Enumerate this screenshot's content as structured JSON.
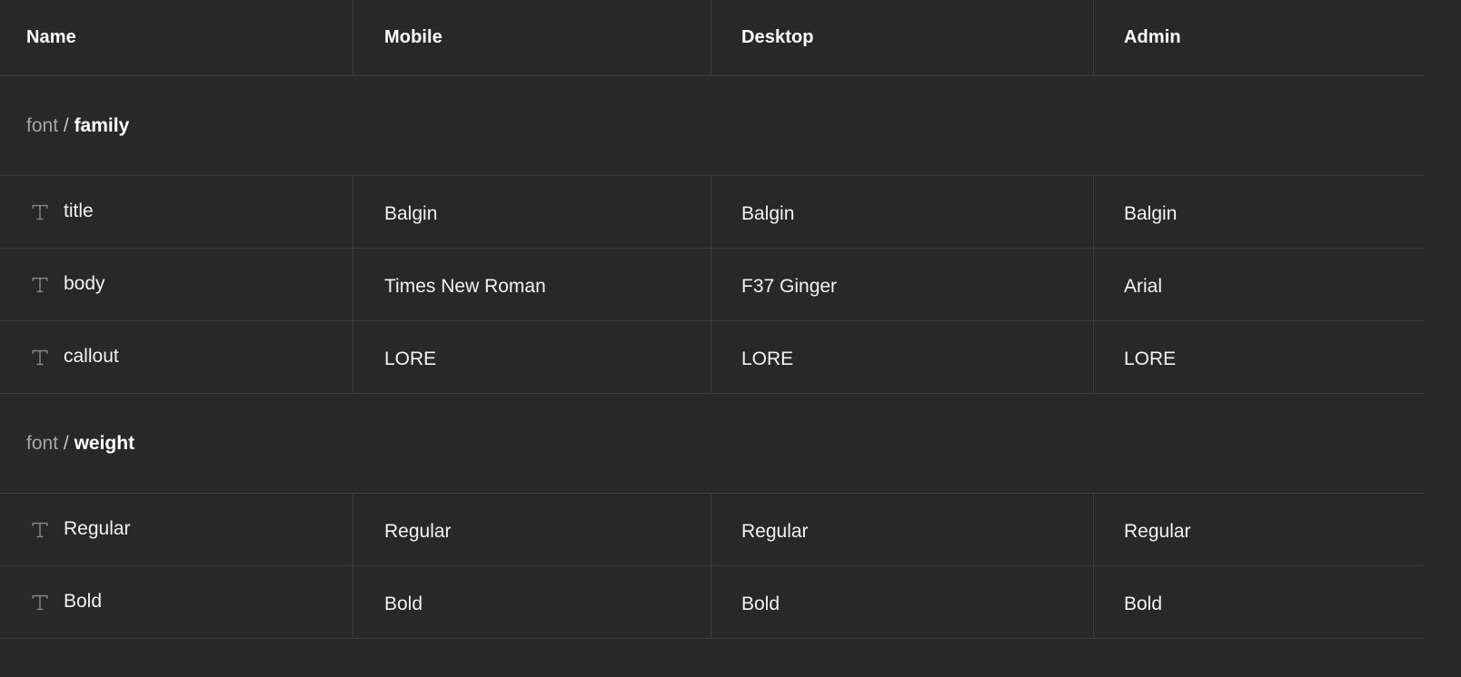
{
  "table": {
    "columns": [
      {
        "key": "name",
        "label": "Name"
      },
      {
        "key": "mobile",
        "label": "Mobile"
      },
      {
        "key": "desktop",
        "label": "Desktop"
      },
      {
        "key": "admin",
        "label": "Admin"
      }
    ],
    "groups": [
      {
        "prefix": "font",
        "separator": "/",
        "name": "family",
        "rows": [
          {
            "icon": "text-type-icon",
            "name": "title",
            "mobile": "Balgin",
            "desktop": "Balgin",
            "admin": "Balgin"
          },
          {
            "icon": "text-type-icon",
            "name": "body",
            "mobile": "Times New Roman",
            "desktop": "F37 Ginger",
            "admin": "Arial"
          },
          {
            "icon": "text-type-icon",
            "name": "callout",
            "mobile": "LORE",
            "desktop": "LORE",
            "admin": "LORE"
          }
        ]
      },
      {
        "prefix": "font",
        "separator": "/",
        "name": "weight",
        "rows": [
          {
            "icon": "text-type-icon",
            "name": "Regular",
            "mobile": "Regular",
            "desktop": "Regular",
            "admin": "Regular"
          },
          {
            "icon": "text-type-icon",
            "name": "Bold",
            "mobile": "Bold",
            "desktop": "Bold",
            "admin": "Bold"
          }
        ]
      }
    ]
  },
  "colors": {
    "background": "#282828",
    "border": "#3d3d3d",
    "text_primary": "#f2f2f2",
    "text_muted": "#a6a6a6",
    "icon": "#8a8a8a"
  }
}
